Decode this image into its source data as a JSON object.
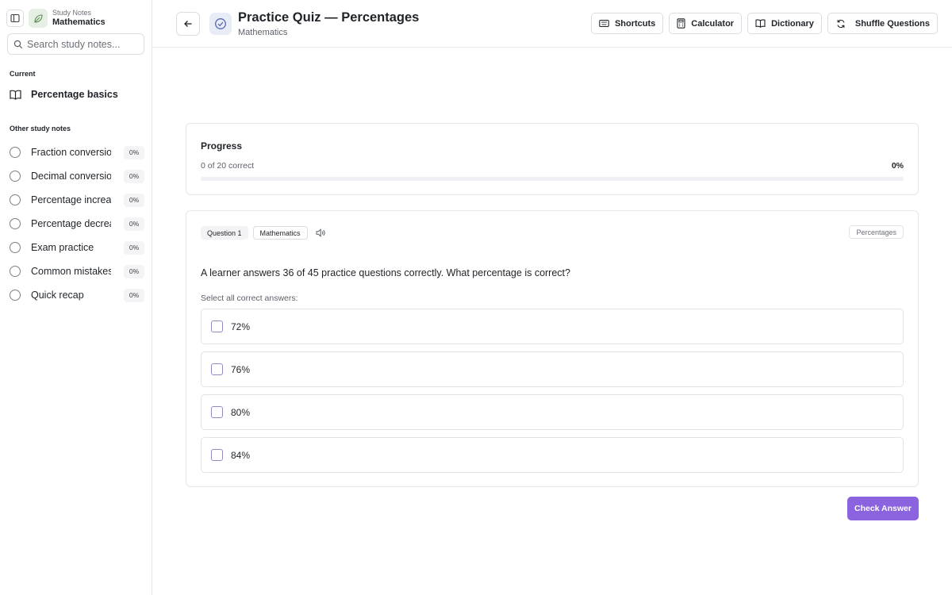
{
  "sidebar": {
    "brand_sub": "Study Notes",
    "brand_main": "Mathematics",
    "search_placeholder": "Search study notes...",
    "current_label": "Current",
    "current_item": "Percentage basics",
    "other_label": "Other study notes",
    "notes": [
      {
        "label": "Fraction conversions",
        "progress": "0%"
      },
      {
        "label": "Decimal conversions",
        "progress": "0%"
      },
      {
        "label": "Percentage increase",
        "progress": "0%"
      },
      {
        "label": "Percentage decrease",
        "progress": "0%"
      },
      {
        "label": "Exam practice",
        "progress": "0%"
      },
      {
        "label": "Common mistakes",
        "progress": "0%"
      },
      {
        "label": "Quick recap",
        "progress": "0%"
      }
    ]
  },
  "header": {
    "title": "Practice Quiz — Percentages",
    "subtitle": "Mathematics",
    "tools": {
      "shortcuts": "Shortcuts",
      "calculator": "Calculator",
      "dictionary": "Dictionary",
      "shuffle": "Shuffle Questions"
    }
  },
  "progress": {
    "title": "Progress",
    "count_text": "0 of 20 correct",
    "percent_text": "0%",
    "fraction": 0
  },
  "question": {
    "number_tag": "Question 1",
    "subject_tag": "Mathematics",
    "topic_tag": "Percentages",
    "text": "A learner answers 36 of 45 practice questions correctly. What percentage is correct?",
    "hint": "Select all correct answers:",
    "options": [
      "72%",
      "76%",
      "80%",
      "84%"
    ]
  },
  "actions": {
    "check_answer": "Check Answer"
  },
  "colors": {
    "accent": "#8b63de",
    "progress_track": "#eef0f6"
  }
}
